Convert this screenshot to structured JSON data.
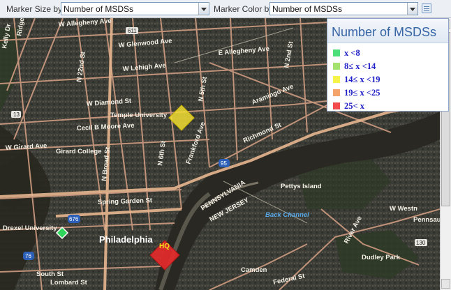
{
  "toolbar": {
    "marker_size_label": "Marker Size by",
    "marker_size_value": "Number of MSDSs",
    "marker_color_label": "Marker Color by",
    "marker_color_value": "Number of MSDSs"
  },
  "legend": {
    "title": "Number of MSDSs",
    "items": [
      {
        "label": "x <8",
        "color": "#4de07a"
      },
      {
        "label": "8≤ x <14",
        "color": "#a3e36d"
      },
      {
        "label": "14≤ x <19",
        "color": "#f7f34a"
      },
      {
        "label": "19≤ x <25",
        "color": "#f4a36a"
      },
      {
        "label": "25< x",
        "color": "#f24b4b"
      }
    ]
  },
  "map": {
    "labels": {
      "allegheny_w": "W Allegheny Ave",
      "allegheny_e": "E Allegheny Ave",
      "glenwood": "W Glenwood Ave",
      "lehigh": "W Lehigh Ave",
      "diamond": "W Diamond St",
      "temple": "Temple University",
      "cecil": "Cecil B Moore Ave",
      "girard": "W Girard Ave",
      "girard_college": "Girard College",
      "spring_garden": "Spring Garden St",
      "drexel": "Drexel University",
      "philadelphia": "Philadelphia",
      "hq": "HQ",
      "pennsylvania": "PENNSYLVANIA",
      "new_jersey": "NEW JERSEY",
      "back_channel": "Back Channel",
      "pettys": "Pettys Island",
      "camden": "Camden",
      "richmond": "Richmond St",
      "aramingo": "Aramingo Ave",
      "frankford": "Frankford Ave",
      "broad": "N Broad St",
      "rt13": "13",
      "rt95": "95",
      "rt676": "676",
      "rt611": "611",
      "rt130": "130",
      "rt76": "76",
      "rt30": "30",
      "south": "South St",
      "lombard": "Lombard St",
      "river": "River Ave",
      "dudley": "Dudley Park",
      "penns": "Pennsau",
      "westn": "W Westn",
      "federal": "Federal St",
      "cambridge": "W Cambria St",
      "n2nd": "N 2nd St",
      "n5th": "N 5th St",
      "n6th": "N 6th St",
      "n22nd": "N 22nd St",
      "n10th": "N 10th St",
      "n16th": "N 16th St",
      "ridge": "Ridge Ave",
      "kelly": "Kelly Dr",
      "lehigh_e": "E Lehigh Ave",
      "n4th": "N 4th St",
      "n29th": "N 29th St",
      "n18th": "N 18th St",
      "wcumberland": "W Cumberland St",
      "n33rd": "N 33rd St",
      "n12th": "N 12th St",
      "n8th": "N 8th St"
    },
    "markers": [
      {
        "name": "marker-yellow",
        "color": "#f2dd33"
      },
      {
        "name": "marker-green",
        "color": "#2fd65a"
      },
      {
        "name": "marker-red",
        "color": "#e82a2a"
      }
    ]
  }
}
